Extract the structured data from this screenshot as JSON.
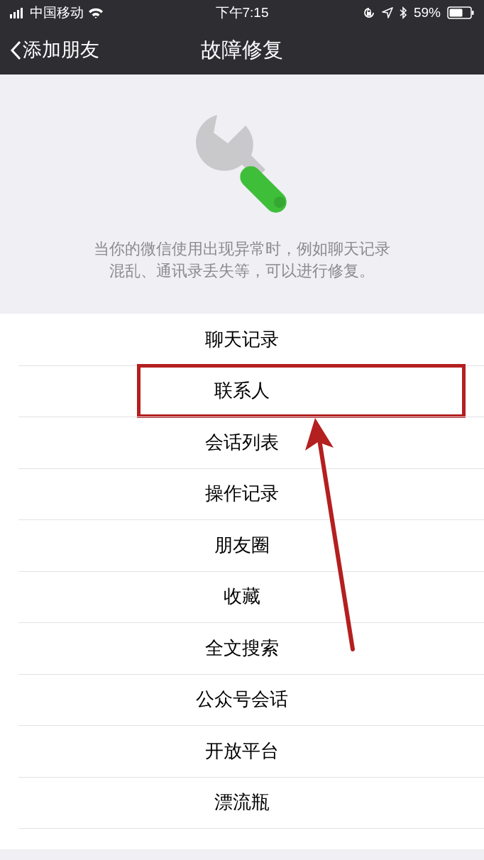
{
  "status_bar": {
    "carrier": "中国移动",
    "time": "下午7:15",
    "battery": "59%"
  },
  "nav": {
    "back": "添加朋友",
    "title": "故障修复"
  },
  "description": "当你的微信使用出现异常时，例如聊天记录混乱、通讯录丢失等，可以进行修复。",
  "items": [
    {
      "label": "聊天记录",
      "annotated": false
    },
    {
      "label": "联系人",
      "annotated": true
    },
    {
      "label": "会话列表",
      "annotated": false
    },
    {
      "label": "操作记录",
      "annotated": false
    },
    {
      "label": "朋友圈",
      "annotated": false
    },
    {
      "label": "收藏",
      "annotated": false
    },
    {
      "label": "全文搜索",
      "annotated": false
    },
    {
      "label": "公众号会话",
      "annotated": false
    },
    {
      "label": "开放平台",
      "annotated": false
    },
    {
      "label": "漂流瓶",
      "annotated": false
    }
  ]
}
